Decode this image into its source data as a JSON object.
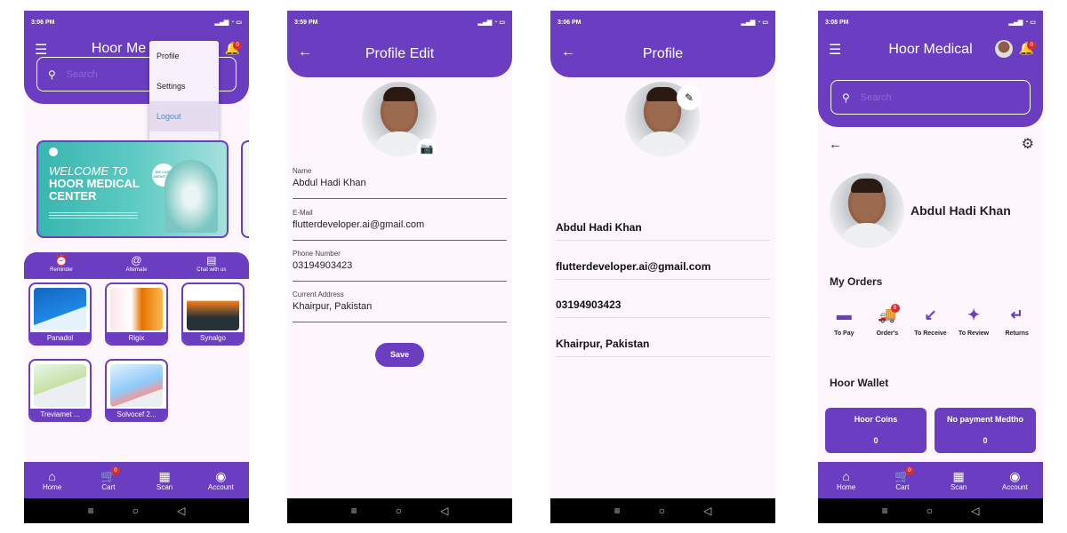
{
  "phone1": {
    "status_time": "3:06 PM",
    "app_title": "Hoor Me",
    "search_placeholder": "Search",
    "notif_count": "0",
    "menu": [
      "Profile",
      "Settings",
      "Logout"
    ],
    "banner": {
      "welcome": "WELCOME TO",
      "line1": "HOOR MEDICAL",
      "line2": "CENTER",
      "care": "WE CARE ABOUT YOU"
    },
    "quick_actions": [
      "Reminder",
      "Alternate",
      "Chat with us"
    ],
    "products": [
      "Panadol",
      "Rigix",
      "Synalgo",
      "Treviamet ...",
      "Solvocef 2..."
    ],
    "nav": [
      {
        "label": "Home"
      },
      {
        "label": "Cart",
        "badge": "0"
      },
      {
        "label": "Scan"
      },
      {
        "label": "Account"
      }
    ]
  },
  "phone2": {
    "status_time": "3:59 PM",
    "title": "Profile Edit",
    "fields": [
      {
        "label": "Name",
        "value": "Abdul Hadi Khan"
      },
      {
        "label": "E-Mail",
        "value": "flutterdeveloper.ai@gmail.com"
      },
      {
        "label": "Phone Number",
        "value": "03194903423"
      },
      {
        "label": "Current Address",
        "value": "Khairpur, Pakistan"
      }
    ],
    "save_label": "Save"
  },
  "phone3": {
    "status_time": "3:06 PM",
    "title": "Profile",
    "name": "Abdul Hadi Khan",
    "email": "flutterdeveloper.ai@gmail.com",
    "phone": "03194903423",
    "address": "Khairpur, Pakistan"
  },
  "phone4": {
    "status_time": "3:08 PM",
    "app_title": "Hoor Medical",
    "search_placeholder": "Search",
    "notif_count": "0",
    "name": "Abdul Hadi Khan",
    "orders_title": "My Orders",
    "orders": [
      {
        "label": "To Pay"
      },
      {
        "label": "Order's",
        "badge": "0"
      },
      {
        "label": "To Receive"
      },
      {
        "label": "To Review"
      },
      {
        "label": "Returns"
      }
    ],
    "wallet_title": "Hoor Wallet",
    "wallet": [
      {
        "label": "Hoor Coins",
        "value": "0"
      },
      {
        "label": "No payment Medtho",
        "value": "0"
      }
    ],
    "nav": [
      {
        "label": "Home"
      },
      {
        "label": "Cart",
        "badge": "0"
      },
      {
        "label": "Scan"
      },
      {
        "label": "Account"
      }
    ]
  },
  "colors": {
    "primary": "#6a3dc1",
    "background": "#fdf6fd",
    "badge": "#d32f2f",
    "link": "#2196f3"
  },
  "icons": [
    "menu-icon",
    "bell-icon",
    "search-icon",
    "back-arrow-icon",
    "camera-icon",
    "edit-pencil-icon",
    "gear-icon",
    "home-icon",
    "cart-icon",
    "scan-icon",
    "account-icon",
    "alarm-icon",
    "at-icon",
    "chat-icon",
    "card-icon",
    "truck-icon",
    "arrow-down-left-icon",
    "review-icon",
    "return-icon"
  ]
}
